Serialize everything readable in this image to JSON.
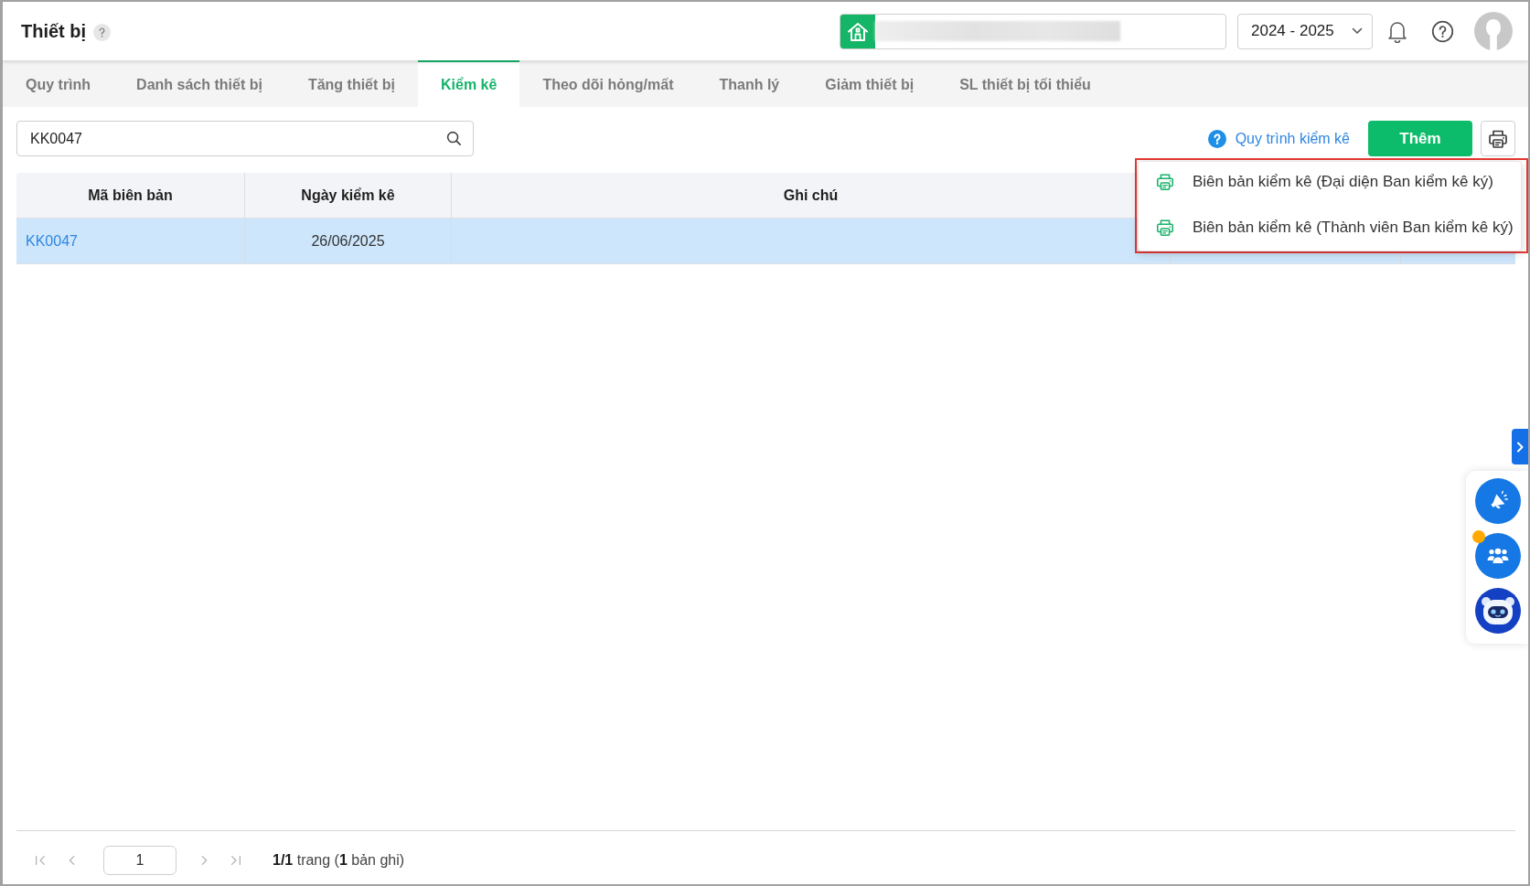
{
  "header": {
    "title": "Thiết bị",
    "year_selector": {
      "value": "2024 - 2025"
    }
  },
  "tabs": [
    {
      "label": "Quy trình",
      "selected": false
    },
    {
      "label": "Danh sách thiết bị",
      "selected": false
    },
    {
      "label": "Tăng thiết bị",
      "selected": false
    },
    {
      "label": "Kiểm kê",
      "selected": true
    },
    {
      "label": "Theo dõi hỏng/mất",
      "selected": false
    },
    {
      "label": "Thanh lý",
      "selected": false
    },
    {
      "label": "Giảm thiết bị",
      "selected": false
    },
    {
      "label": "SL thiết bị tối thiểu",
      "selected": false
    }
  ],
  "toolbar": {
    "search": {
      "value": "KK0047"
    },
    "help_link": {
      "label": "Quy trình kiểm kê"
    },
    "add_button": {
      "label": "Thêm"
    }
  },
  "table": {
    "columns": [
      {
        "label": "Mã biên bản"
      },
      {
        "label": "Ngày kiểm kê"
      },
      {
        "label": "Ghi chú"
      }
    ],
    "rows": [
      {
        "code": "KK0047",
        "date": "26/06/2025",
        "selected": true
      }
    ]
  },
  "print_menu": {
    "items": [
      {
        "label": "Biên bản kiểm kê (Đại diện Ban kiểm kê ký)"
      },
      {
        "label": "Biên bản kiểm kê (Thành viên Ban kiểm kê ký)"
      }
    ]
  },
  "pagination": {
    "first": {
      "disabled": true
    },
    "prev": {
      "disabled": true
    },
    "page": "1",
    "next": {
      "disabled": true
    },
    "last": {
      "disabled": true
    },
    "summary": "**1/1** trang (**1** bản ghi)"
  },
  "side_widgets": [
    {
      "kind": "announcement",
      "badge": false
    },
    {
      "kind": "community",
      "badge": true
    },
    {
      "kind": "assistant",
      "badge": false
    }
  ]
}
